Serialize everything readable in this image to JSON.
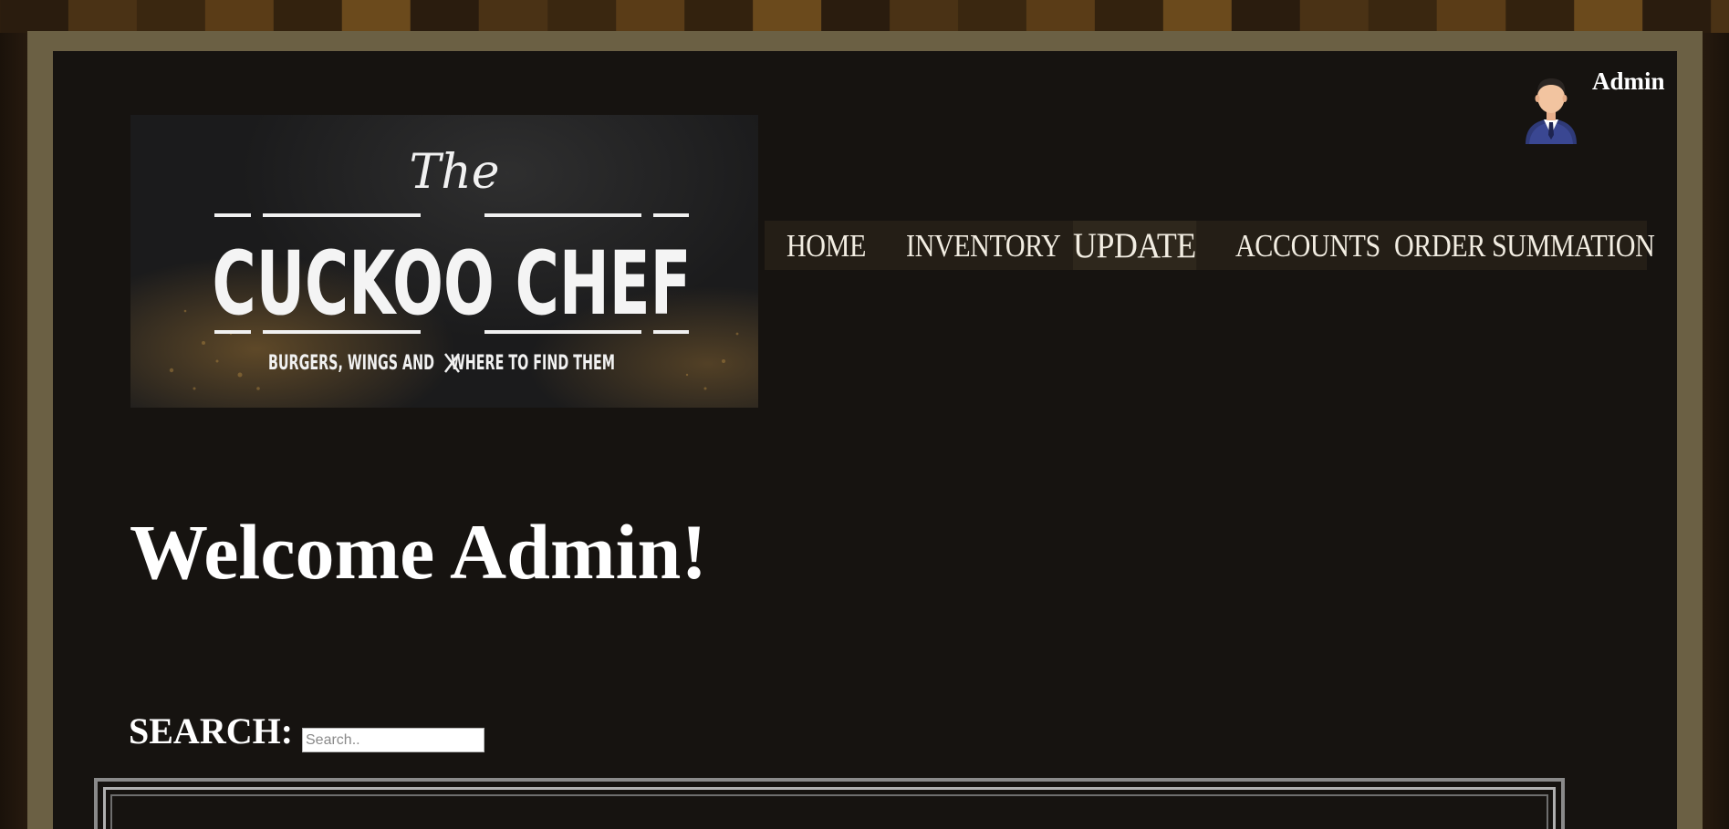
{
  "user": {
    "name": "Admin",
    "avatar_icon": "businessman-avatar-icon"
  },
  "logo": {
    "line1": "The",
    "line2": "CUCKOO CHEF",
    "line3": "BURGERS, WINGS AND",
    "line3b": "WHERE TO FIND THEM"
  },
  "nav": {
    "items": [
      {
        "label": "HOME"
      },
      {
        "label": "INVENTORY"
      },
      {
        "label": "UPDATE"
      },
      {
        "label": "ACCOUNTS"
      },
      {
        "label": "ORDER SUMMATION"
      }
    ],
    "active": "UPDATE"
  },
  "main": {
    "welcome": "Welcome Admin!",
    "search_label": "SEARCH:",
    "search_placeholder": "Search..",
    "search_value": ""
  },
  "colors": {
    "panel_bg": "#161310",
    "frame": "#6b6044",
    "nav_bg": "#241e16",
    "text": "#ffffff"
  }
}
